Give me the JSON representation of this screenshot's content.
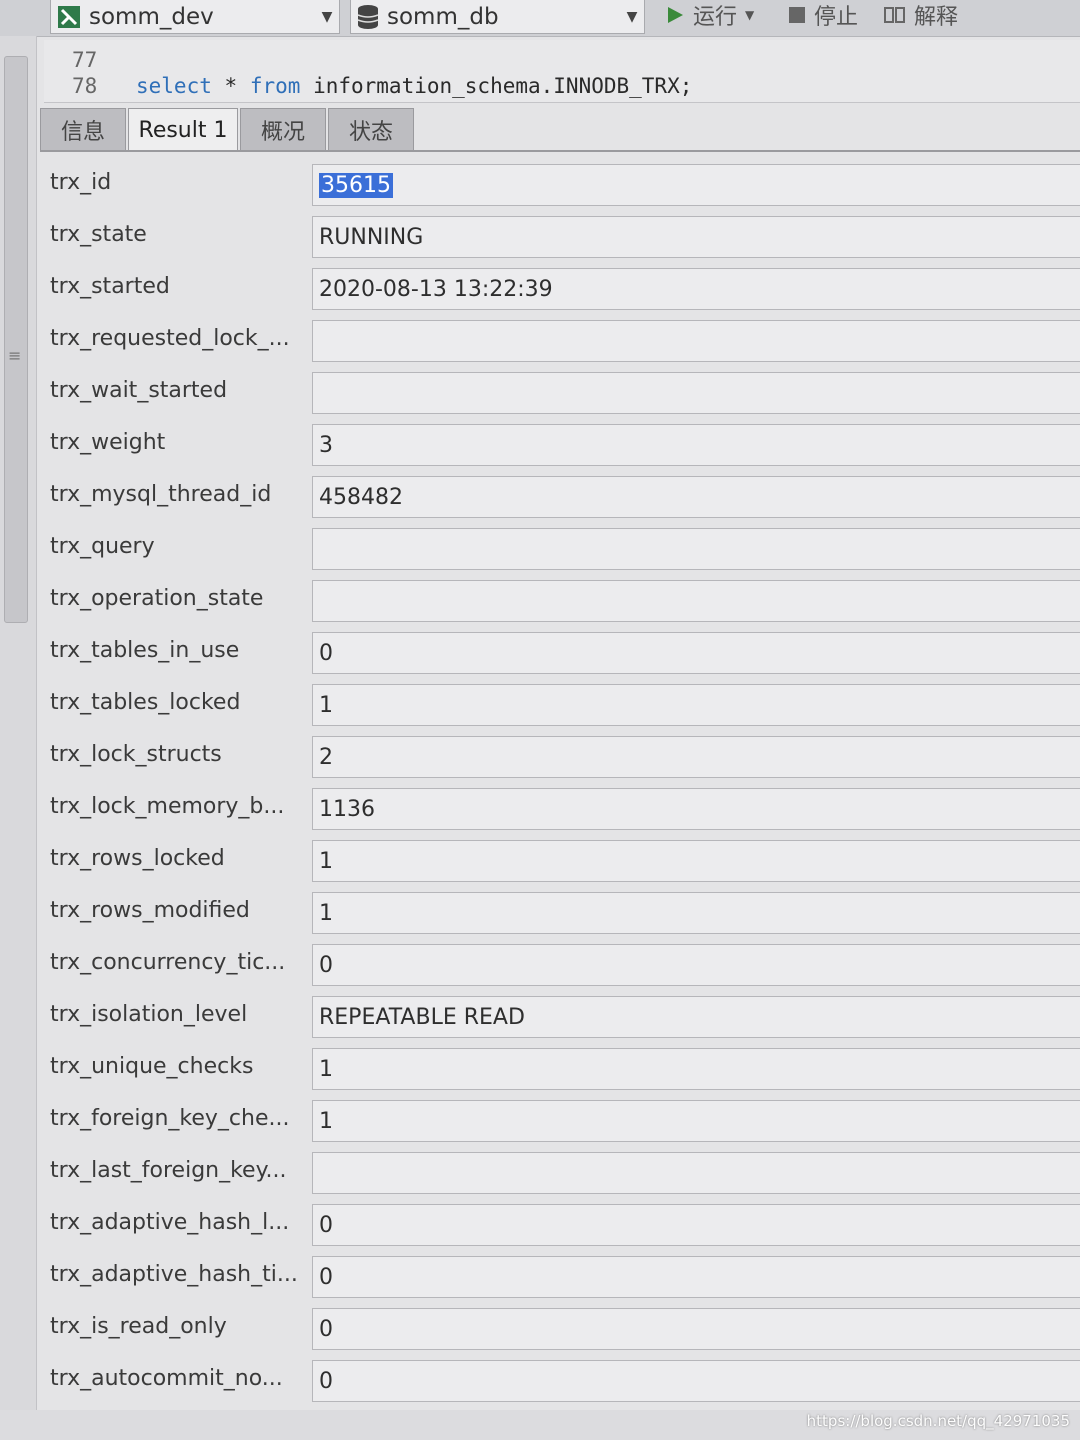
{
  "toolbar": {
    "connection": "somm_dev",
    "database": "somm_db",
    "run_label": "运行",
    "stop_label": "停止",
    "explain_label": "解释"
  },
  "editor": {
    "line1_no": "77",
    "line2_no": "78",
    "kw_select": "select",
    "star": "*",
    "kw_from": "from",
    "table": "information_schema.INNODB_TRX;"
  },
  "tabs": [
    "信息",
    "Result 1",
    "概况",
    "状态"
  ],
  "fields": [
    {
      "label": "trx_id",
      "value": "35615"
    },
    {
      "label": "trx_state",
      "value": "RUNNING"
    },
    {
      "label": "trx_started",
      "value": "2020-08-13 13:22:39"
    },
    {
      "label": "trx_requested_lock_...",
      "value": ""
    },
    {
      "label": "trx_wait_started",
      "value": ""
    },
    {
      "label": "trx_weight",
      "value": "3"
    },
    {
      "label": "trx_mysql_thread_id",
      "value": "458482"
    },
    {
      "label": "trx_query",
      "value": ""
    },
    {
      "label": "trx_operation_state",
      "value": ""
    },
    {
      "label": "trx_tables_in_use",
      "value": "0"
    },
    {
      "label": "trx_tables_locked",
      "value": "1"
    },
    {
      "label": "trx_lock_structs",
      "value": "2"
    },
    {
      "label": "trx_lock_memory_b...",
      "value": "1136"
    },
    {
      "label": "trx_rows_locked",
      "value": "1"
    },
    {
      "label": "trx_rows_modified",
      "value": "1"
    },
    {
      "label": "trx_concurrency_tic...",
      "value": "0"
    },
    {
      "label": "trx_isolation_level",
      "value": "REPEATABLE READ"
    },
    {
      "label": "trx_unique_checks",
      "value": "1"
    },
    {
      "label": "trx_foreign_key_che...",
      "value": "1"
    },
    {
      "label": "trx_last_foreign_key...",
      "value": ""
    },
    {
      "label": "trx_adaptive_hash_l...",
      "value": "0"
    },
    {
      "label": "trx_adaptive_hash_ti...",
      "value": "0"
    },
    {
      "label": "trx_is_read_only",
      "value": "0"
    },
    {
      "label": "trx_autocommit_no...",
      "value": "0"
    }
  ],
  "watermark": "https://blog.csdn.net/qq_42971035",
  "colors": {
    "keyword": "#2f6fb8",
    "selection": "#3b6fd8",
    "active_tab": "#eeeeef"
  },
  "icons": {
    "connection": "connection-icon",
    "database": "database-icon",
    "run": "play-icon",
    "stop": "stop-icon",
    "explain": "explain-icon"
  }
}
